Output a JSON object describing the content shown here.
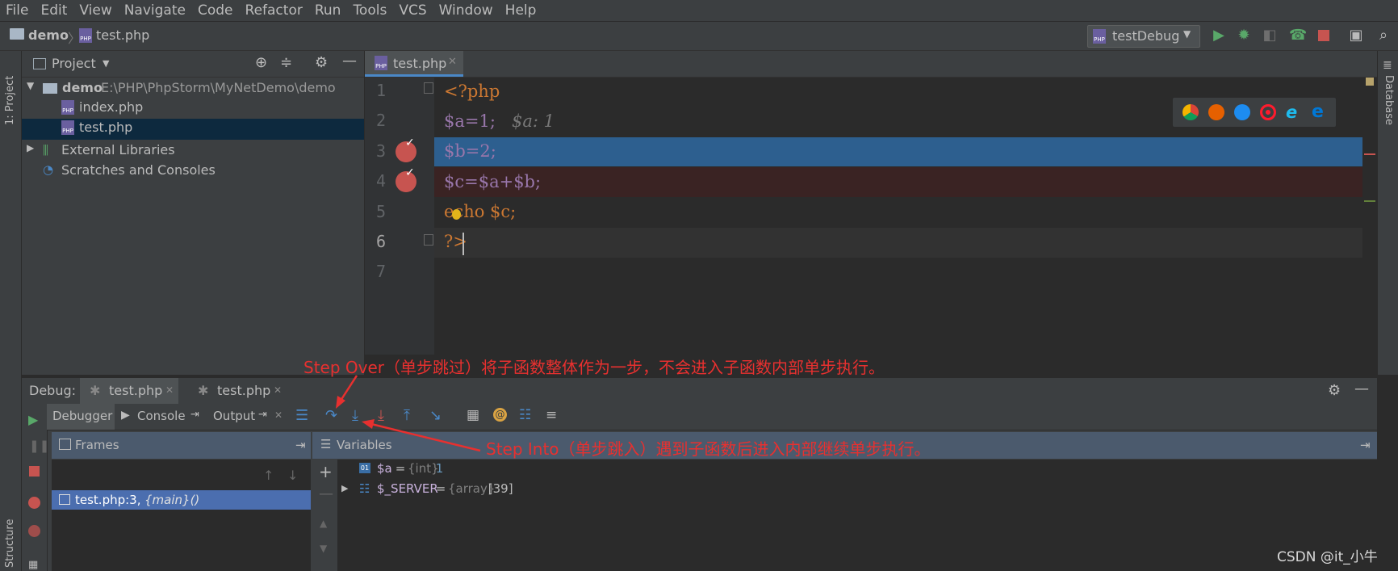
{
  "menu": [
    "File",
    "Edit",
    "View",
    "Navigate",
    "Code",
    "Refactor",
    "Run",
    "Tools",
    "VCS",
    "Window",
    "Help"
  ],
  "breadcrumb": {
    "project": "demo",
    "file": "test.php"
  },
  "run_config": {
    "name": "testDebug"
  },
  "left_strip": {
    "project_label": "1: Project",
    "structure_label": "Structure"
  },
  "right_strip": {
    "database_label": "Database"
  },
  "project_panel": {
    "title": "Project",
    "root_name": "demo",
    "root_path": "E:\\PHP\\PhpStorm\\MyNetDemo\\demo",
    "files": [
      "index.php",
      "test.php"
    ],
    "external_libraries": "External Libraries",
    "scratches": "Scratches and Consoles"
  },
  "editor": {
    "tab_label": "test.php",
    "line_numbers": [
      "1",
      "2",
      "3",
      "4",
      "5",
      "6",
      "7"
    ],
    "lines": [
      {
        "text": "<?php"
      },
      {
        "text": "$a=1;",
        "hint": "$a: 1"
      },
      {
        "text": "$b=2;"
      },
      {
        "text": "$c=$a+$b;"
      },
      {
        "text": "echo $c;"
      },
      {
        "text": "?>"
      },
      {
        "text": ""
      }
    ]
  },
  "annotations": {
    "step_over": "Step Over（单步跳过）将子函数整体作为一步，不会进入子函数内部单步执行。",
    "step_into": "Step Into（单步跳入）遇到子函数后进入内部继续单步执行。"
  },
  "debug": {
    "label": "Debug:",
    "tabs": [
      "test.php",
      "test.php"
    ],
    "subtabs": {
      "debugger": "Debugger",
      "console": "Console",
      "output": "Output"
    },
    "frames_label": "Frames",
    "variables_label": "Variables",
    "frame": {
      "location": "test.php:3,",
      "scope": "{main}()"
    },
    "variables": [
      {
        "name": "$a",
        "eq": " = ",
        "type": "{int}",
        "value": " 1"
      },
      {
        "name": "$_SERVER",
        "eq": " = ",
        "type": "{array}",
        "value": " [39]"
      }
    ]
  },
  "watermark": "CSDN @it_小牛",
  "colors": {
    "accent": "#4a88c7",
    "annotation": "#e8302f",
    "breakpoint": "#c75450",
    "exec_line": "#2d5f8f",
    "bp_line": "#3a2323"
  }
}
